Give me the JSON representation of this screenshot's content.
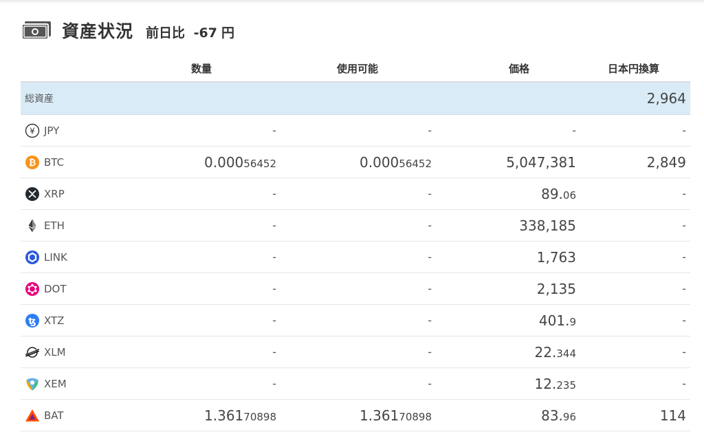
{
  "header": {
    "title": "資産状況",
    "change_label": "前日比",
    "change_value": "-67",
    "change_unit": "円"
  },
  "columns": {
    "quantity": "数量",
    "available": "使用可能",
    "price": "価格",
    "jpy_value": "日本円換算"
  },
  "total": {
    "label": "総資産",
    "jpy_value": "2,964"
  },
  "rows": [
    {
      "symbol": "JPY",
      "icon": "yen-icon",
      "qty_main": "-",
      "qty_small": "",
      "avail_main": "-",
      "avail_small": "",
      "price_main": "-",
      "price_small": "",
      "jpy": "-"
    },
    {
      "symbol": "BTC",
      "icon": "bitcoin-icon",
      "qty_main": "0.000",
      "qty_small": "56452",
      "avail_main": "0.000",
      "avail_small": "56452",
      "price_main": "5,047,381",
      "price_small": "",
      "jpy": "2,849"
    },
    {
      "symbol": "XRP",
      "icon": "xrp-icon",
      "qty_main": "-",
      "qty_small": "",
      "avail_main": "-",
      "avail_small": "",
      "price_main": "89.",
      "price_small": "06",
      "jpy": "-"
    },
    {
      "symbol": "ETH",
      "icon": "ethereum-icon",
      "qty_main": "-",
      "qty_small": "",
      "avail_main": "-",
      "avail_small": "",
      "price_main": "338,185",
      "price_small": "",
      "jpy": "-"
    },
    {
      "symbol": "LINK",
      "icon": "chainlink-icon",
      "qty_main": "-",
      "qty_small": "",
      "avail_main": "-",
      "avail_small": "",
      "price_main": "1,763",
      "price_small": "",
      "jpy": "-"
    },
    {
      "symbol": "DOT",
      "icon": "polkadot-icon",
      "qty_main": "-",
      "qty_small": "",
      "avail_main": "-",
      "avail_small": "",
      "price_main": "2,135",
      "price_small": "",
      "jpy": "-"
    },
    {
      "symbol": "XTZ",
      "icon": "tezos-icon",
      "qty_main": "-",
      "qty_small": "",
      "avail_main": "-",
      "avail_small": "",
      "price_main": "401.",
      "price_small": "9",
      "jpy": "-"
    },
    {
      "symbol": "XLM",
      "icon": "stellar-icon",
      "qty_main": "-",
      "qty_small": "",
      "avail_main": "-",
      "avail_small": "",
      "price_main": "22.",
      "price_small": "344",
      "jpy": "-"
    },
    {
      "symbol": "XEM",
      "icon": "nem-icon",
      "qty_main": "-",
      "qty_small": "",
      "avail_main": "-",
      "avail_small": "",
      "price_main": "12.",
      "price_small": "235",
      "jpy": "-"
    },
    {
      "symbol": "BAT",
      "icon": "bat-icon",
      "qty_main": "1.361",
      "qty_small": "70898",
      "avail_main": "1.361",
      "avail_small": "70898",
      "price_main": "83.",
      "price_small": "96",
      "jpy": "114"
    }
  ],
  "colors": {
    "total_row_bg": "#d9ebf6",
    "bitcoin": "#f7931a",
    "chainlink": "#2a5ada",
    "polkadot": "#e6007a",
    "tezos": "#2c7df7",
    "bat": "#ff5000"
  }
}
